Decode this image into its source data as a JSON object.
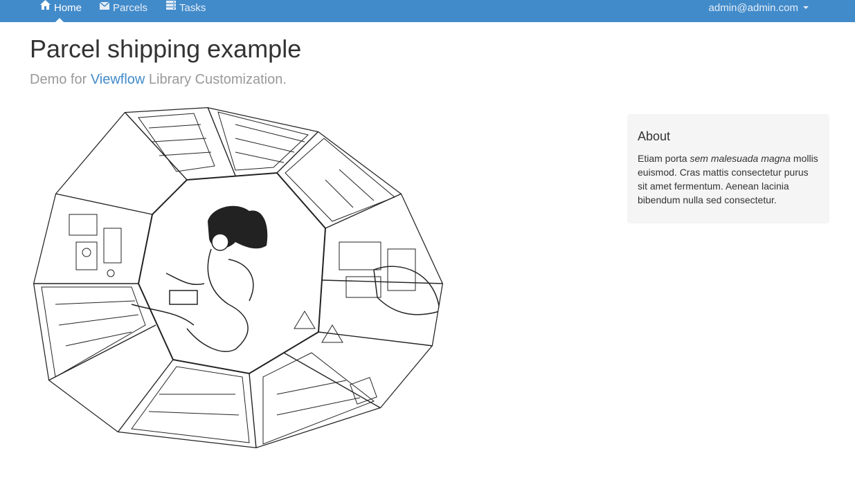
{
  "navbar": {
    "items": [
      {
        "label": "Home",
        "icon": "home-icon",
        "active": true
      },
      {
        "label": "Parcels",
        "icon": "envelope-icon",
        "active": false
      },
      {
        "label": "Tasks",
        "icon": "tasks-icon",
        "active": false
      }
    ],
    "user": "admin@admin.com",
    "color": "#428bca"
  },
  "header": {
    "title": "Parcel shipping example",
    "lead_prefix": "Demo for ",
    "lead_link": "Viewflow",
    "lead_suffix": " Library Customization."
  },
  "about": {
    "title": "About",
    "text_start": "Etiam porta ",
    "text_em": "sem malesuada magna",
    "text_end": " mollis euismod. Cras mattis consectetur purus sit amet fermentum. Aenean lacinia bibendum nulla sed consectetur."
  },
  "illustration": {
    "subject": "hand-drawn sketch of astronaut floating inside spaceship cabin"
  },
  "colors": {
    "link": "#428bca",
    "muted": "#999999",
    "panel": "#f5f5f5"
  }
}
